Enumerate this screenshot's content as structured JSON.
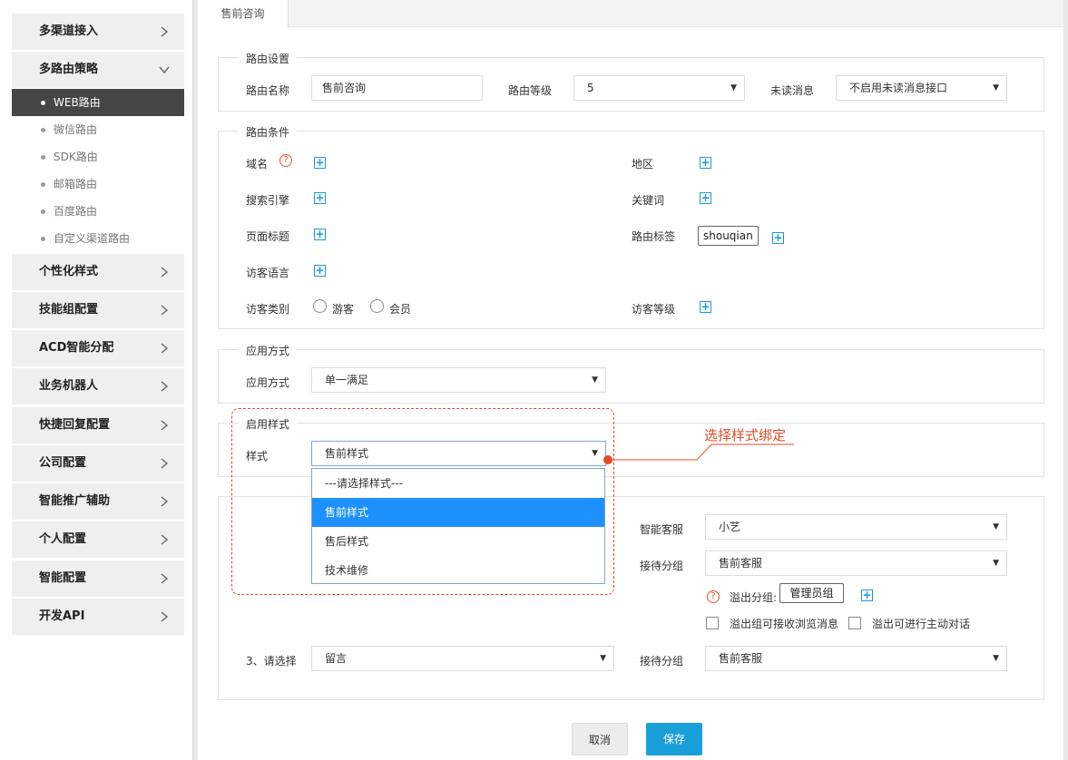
{
  "sidebar": {
    "groups_top": [
      {
        "label": "多渠道接入",
        "expanded": false
      },
      {
        "label": "多路由策略",
        "expanded": true
      }
    ],
    "sub_items": [
      {
        "label": "WEB路由",
        "active": true
      },
      {
        "label": "微信路由",
        "active": false
      },
      {
        "label": "SDK路由",
        "active": false
      },
      {
        "label": "邮箱路由",
        "active": false
      },
      {
        "label": "百度路由",
        "active": false
      },
      {
        "label": "自定义渠道路由",
        "active": false
      }
    ],
    "groups_bottom": [
      {
        "label": "个性化样式"
      },
      {
        "label": "技能组配置"
      },
      {
        "label": "ACD智能分配"
      },
      {
        "label": "业务机器人"
      },
      {
        "label": "快捷回复配置"
      },
      {
        "label": "公司配置"
      },
      {
        "label": "智能推广辅助"
      },
      {
        "label": "个人配置"
      },
      {
        "label": "智能配置"
      },
      {
        "label": "开发API"
      }
    ]
  },
  "tab": {
    "label": "售前咨询"
  },
  "route_settings": {
    "legend": "路由设置",
    "name_label": "路由名称",
    "name_value": "售前咨询",
    "level_label": "路由等级",
    "level_value": "5",
    "unread_label": "未读消息",
    "unread_value": "不启用未读消息接口"
  },
  "route_conditions": {
    "legend": "路由条件",
    "domain_label": "域名",
    "region_label": "地区",
    "search_engine_label": "搜索引擎",
    "keyword_label": "关键词",
    "page_title_label": "页面标题",
    "route_tag_label": "路由标签",
    "route_tag_value": "shouqian",
    "visitor_language_label": "访客语言",
    "visitor_type_label": "访客类别",
    "visitor_type_options": [
      "游客",
      "会员"
    ],
    "visitor_level_label": "访客等级"
  },
  "apply_mode": {
    "legend": "应用方式",
    "label": "应用方式",
    "value": "单一满足"
  },
  "style_section": {
    "legend": "启用样式",
    "label": "样式",
    "value": "售前样式",
    "options": [
      {
        "label": "---请选择样式---",
        "selected": false
      },
      {
        "label": "售前样式",
        "selected": true
      },
      {
        "label": "售后样式",
        "selected": false
      },
      {
        "label": "技术维修",
        "selected": false
      }
    ]
  },
  "annotation": {
    "text": "选择样式绑定"
  },
  "service": {
    "smart_service_label": "智能客服",
    "smart_service_value": "小艺",
    "reception_group_label": "接待分组",
    "reception_group_value": "售前客服",
    "overflow_label": "溢出分组:",
    "overflow_tag": "管理员组",
    "overflow_browse_label": "溢出组可接收浏览消息",
    "overflow_active_label": "溢出可进行主动对话",
    "step3_label": "3、请选择",
    "step3_value": "留言",
    "reception_group2_label": "接待分组",
    "reception_group2_value": "售前客服"
  },
  "buttons": {
    "cancel": "取消",
    "save": "保存"
  },
  "colors": {
    "accent": "#1aa0d9",
    "annotation": "#e04a2a",
    "active_menu": "#454545",
    "selected_option": "#1e90ff"
  }
}
